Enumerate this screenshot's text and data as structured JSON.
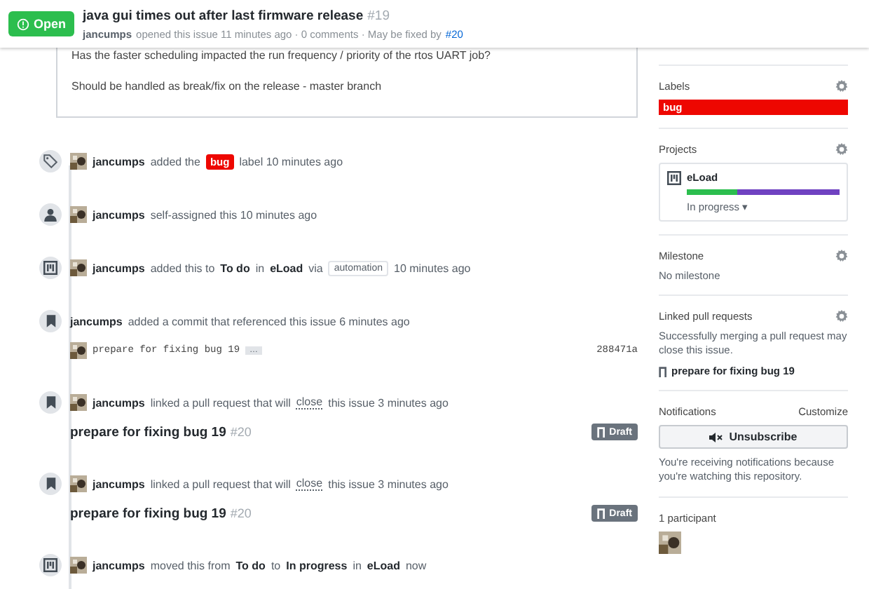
{
  "header": {
    "state": "Open",
    "title": "java gui times out after last firmware release",
    "number": "#19",
    "author": "jancumps",
    "meta": "opened this issue 11 minutes ago · 0 comments · May be fixed by",
    "fixed_by": "#20"
  },
  "comment_paragraphs": [
    "Has the faster scheduling impacted the run frequency / priority of the rtos UART job?",
    "Should be handled as break/fix on the release - master branch"
  ],
  "events": [
    {
      "kind": "labeled",
      "avatar": true,
      "actor": "jancumps",
      "parts": [
        {
          "kind": "text",
          "text": "added the"
        },
        {
          "kind": "label",
          "text": "bug",
          "color": "#ee0701"
        },
        {
          "kind": "text",
          "text": "label 10 minutes ago"
        }
      ]
    },
    {
      "kind": "assigned",
      "avatar": true,
      "actor": "jancumps",
      "parts": [
        {
          "kind": "text",
          "text": "self-assigned this 10 minutes ago"
        }
      ]
    },
    {
      "kind": "project",
      "avatar": true,
      "actor": "jancumps",
      "parts": [
        {
          "kind": "text",
          "text": "added this to"
        },
        {
          "kind": "bold",
          "text": "To do"
        },
        {
          "kind": "text",
          "text": "in"
        },
        {
          "kind": "bold",
          "text": "eLoad"
        },
        {
          "kind": "text",
          "text": "via"
        },
        {
          "kind": "tag",
          "text": "automation"
        },
        {
          "kind": "text",
          "text": "10 minutes ago"
        }
      ]
    },
    {
      "kind": "referenced",
      "avatar": false,
      "actor": "jancumps",
      "parts": [
        {
          "kind": "text",
          "text": "added a commit that referenced this issue 6 minutes ago"
        }
      ],
      "commit": {
        "message": "prepare for fixing bug 19",
        "more": "…",
        "sha": "288471a"
      }
    },
    {
      "kind": "linked",
      "avatar": true,
      "actor": "jancumps",
      "parts": [
        {
          "kind": "text",
          "text": "linked a pull request that will"
        },
        {
          "kind": "underline",
          "text": "close"
        },
        {
          "kind": "text",
          "text": "this issue 3 minutes ago"
        }
      ],
      "pr": {
        "title": "prepare for fixing bug 19",
        "number": "#20",
        "badge": "Draft"
      }
    },
    {
      "kind": "linked",
      "avatar": true,
      "actor": "jancumps",
      "parts": [
        {
          "kind": "text",
          "text": "linked a pull request that will"
        },
        {
          "kind": "underline",
          "text": "close"
        },
        {
          "kind": "text",
          "text": "this issue 3 minutes ago"
        }
      ],
      "pr": {
        "title": "prepare for fixing bug 19",
        "number": "#20",
        "badge": "Draft"
      }
    },
    {
      "kind": "project",
      "avatar": true,
      "actor": "jancumps",
      "parts": [
        {
          "kind": "text",
          "text": "moved this from"
        },
        {
          "kind": "bold",
          "text": "To do"
        },
        {
          "kind": "text",
          "text": "to"
        },
        {
          "kind": "bold",
          "text": "In progress"
        },
        {
          "kind": "text",
          "text": "in"
        },
        {
          "kind": "bold",
          "text": "eLoad"
        },
        {
          "kind": "text",
          "text": "now"
        }
      ]
    }
  ],
  "sidebar": {
    "labels": {
      "title": "Labels",
      "items": [
        {
          "text": "bug",
          "color": "#ee0701"
        }
      ]
    },
    "projects": {
      "title": "Projects",
      "name": "eLoad",
      "column": "In progress",
      "caret": "▾",
      "progress": [
        {
          "color": "#2cbe4e",
          "level": 0.33
        },
        {
          "color": "#6f42c1",
          "level": 0.67
        }
      ]
    },
    "milestone": {
      "title": "Milestone",
      "value": "No milestone"
    },
    "linked": {
      "title": "Linked pull requests",
      "description": "Successfully merging a pull request may close this issue.",
      "pr": "prepare for fixing bug 19"
    },
    "notifications": {
      "title": "Notifications",
      "customize": "Customize",
      "button": "Unsubscribe",
      "note": "You're receiving notifications because you're watching this repository."
    },
    "participants": {
      "title": "1 participant",
      "avatars": [
        {
          "kind": "avatar"
        }
      ]
    }
  }
}
